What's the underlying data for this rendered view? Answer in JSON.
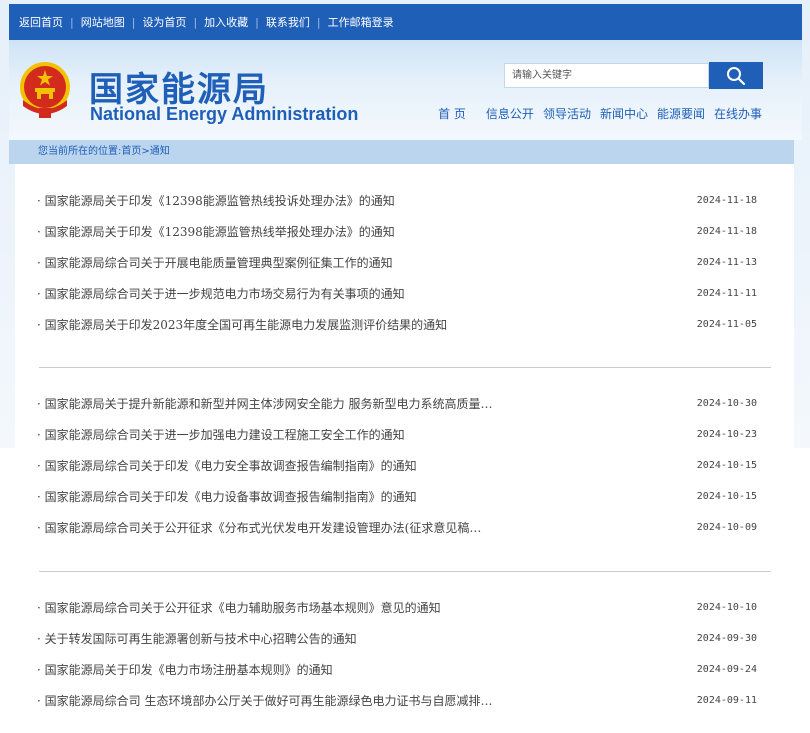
{
  "topbar": {
    "links": [
      "返回首页",
      "网站地图",
      "设为首页",
      "加入收藏",
      "联系我们",
      "工作邮箱登录"
    ]
  },
  "header": {
    "logo_cn": "国家能源局",
    "logo_en": "National Energy Administration",
    "search_placeholder": "请输入关键字",
    "nav": [
      "首 页",
      "信息公开",
      "领导活动",
      "新闻中心",
      "能源要闻",
      "在线办事"
    ]
  },
  "breadcrumb": "您当前所在的位置:首页>通知",
  "groups": [
    {
      "items": [
        {
          "title": "· 国家能源局关于印发《12398能源监管热线投诉处理办法》的通知",
          "date": "2024-11-18"
        },
        {
          "title": "· 国家能源局关于印发《12398能源监管热线举报处理办法》的通知",
          "date": "2024-11-18"
        },
        {
          "title": "· 国家能源局综合司关于开展电能质量管理典型案例征集工作的通知",
          "date": "2024-11-13"
        },
        {
          "title": "· 国家能源局综合司关于进一步规范电力市场交易行为有关事项的通知",
          "date": "2024-11-11"
        },
        {
          "title": "· 国家能源局关于印发2023年度全国可再生能源电力发展监测评价结果的通知",
          "date": "2024-11-05"
        }
      ]
    },
    {
      "items": [
        {
          "title": "· 国家能源局关于提升新能源和新型并网主体涉网安全能力 服务新型电力系统高质量…",
          "date": "2024-10-30"
        },
        {
          "title": "· 国家能源局综合司关于进一步加强电力建设工程施工安全工作的通知",
          "date": "2024-10-23"
        },
        {
          "title": "· 国家能源局综合司关于印发《电力安全事故调查报告编制指南》的通知",
          "date": "2024-10-15"
        },
        {
          "title": "· 国家能源局综合司关于印发《电力设备事故调查报告编制指南》的通知",
          "date": "2024-10-15"
        },
        {
          "title": "· 国家能源局综合司关于公开征求《分布式光伏发电开发建设管理办法(征求意见稿…",
          "date": "2024-10-09"
        }
      ]
    },
    {
      "items": [
        {
          "title": "· 国家能源局综合司关于公开征求《电力辅助服务市场基本规则》意见的通知",
          "date": "2024-10-10"
        },
        {
          "title": "· 关于转发国际可再生能源署创新与技术中心招聘公告的通知",
          "date": "2024-09-30"
        },
        {
          "title": "· 国家能源局关于印发《电力市场注册基本规则》的通知",
          "date": "2024-09-24"
        },
        {
          "title": "· 国家能源局综合司 生态环境部办公厅关于做好可再生能源绿色电力证书与自愿减排…",
          "date": "2024-09-11"
        }
      ]
    }
  ],
  "colors": {
    "brand": "#1f5fb8",
    "breadcrumb_bg": "#bcd5ef",
    "emblem_red": "#d32a1e",
    "emblem_gold": "#f2c200"
  },
  "icons": {
    "search_button": "search-icon",
    "emblem": "national-emblem-icon"
  }
}
